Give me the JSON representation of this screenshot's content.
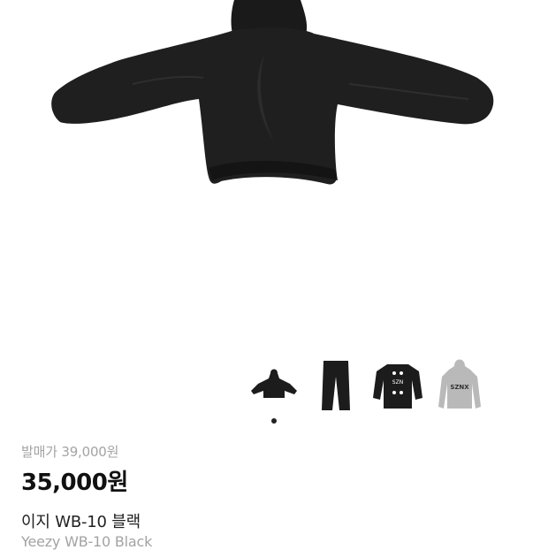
{
  "product": {
    "original_price": "발매가 39,000원",
    "price": "35,000원",
    "name_ko": "이지 WB-10 블랙",
    "name_en": "Yeezy WB-10 Black"
  },
  "thumbnails": [
    {
      "label": "",
      "icon": "black-hoodie-thumb"
    },
    {
      "label": "",
      "icon": "black-pants-thumb"
    },
    {
      "label": "SZN",
      "icon": "black-sweatshirt-thumb"
    },
    {
      "label": "SZNX",
      "icon": "grey-hoodie-thumb"
    }
  ],
  "carousel": {
    "current_index": 1,
    "total": 1
  },
  "colors": {
    "garment": "#1c1c1c",
    "grey": "#b9b9b9",
    "muted_text": "#a3a3a3"
  }
}
